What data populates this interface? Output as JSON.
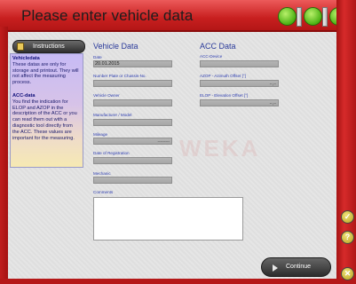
{
  "window": {
    "title": "Please enter vehicle data"
  },
  "sidebar": {
    "instructions_label": "Instructions",
    "paragraphs": [
      {
        "heading": "Vehicledata",
        "body": "These datas are only for storage and printout. They will not affect the measuring process."
      },
      {
        "heading": "ACC-data",
        "body": "You find the indication for ELOP and AZOP in the description of the ACC or you can read them out with a diagnostic tool directly from the ACC. These values are important for the measuring."
      }
    ]
  },
  "vehicle": {
    "title": "Vehicle Data",
    "date_label": "Date",
    "date_value": "20.01.2015",
    "plate_label": "Number Plate or Chassis-No.",
    "plate_value": "",
    "owner_label": "Vehicle Owner",
    "owner_value": "",
    "model_label": "Manufacturer / Model",
    "model_value": "",
    "mileage_label": "Mileage",
    "mileage_value": "",
    "mileage_unit": "---------",
    "registration_label": "Date of Registration",
    "registration_value": "",
    "mechanic_label": "Mechanic",
    "mechanic_value": "",
    "comments_label": "Comments",
    "comments_value": ""
  },
  "acc": {
    "title": "ACC Data",
    "device_label": "ACC-Device",
    "device_value": "",
    "azop_label": "AZOP - Azimuth Offset [°]",
    "azop_value": "",
    "azop_unit": "--,--",
    "elop_label": "ELOP - Elevation Offset [°]",
    "elop_value": "",
    "elop_unit": "--,--"
  },
  "footer": {
    "continue_label": "Continue"
  },
  "side_buttons": {
    "ok_glyph": "✓",
    "help_glyph": "?",
    "close_glyph": "✕"
  },
  "watermark": "WEKA",
  "colors": {
    "frame_red": "#c81f1f",
    "indicator_green": "#4bb113",
    "label_blue": "#2d3db0",
    "panel_lavender": "#c7bbf5",
    "panel_yellow": "#f6e9b3"
  }
}
